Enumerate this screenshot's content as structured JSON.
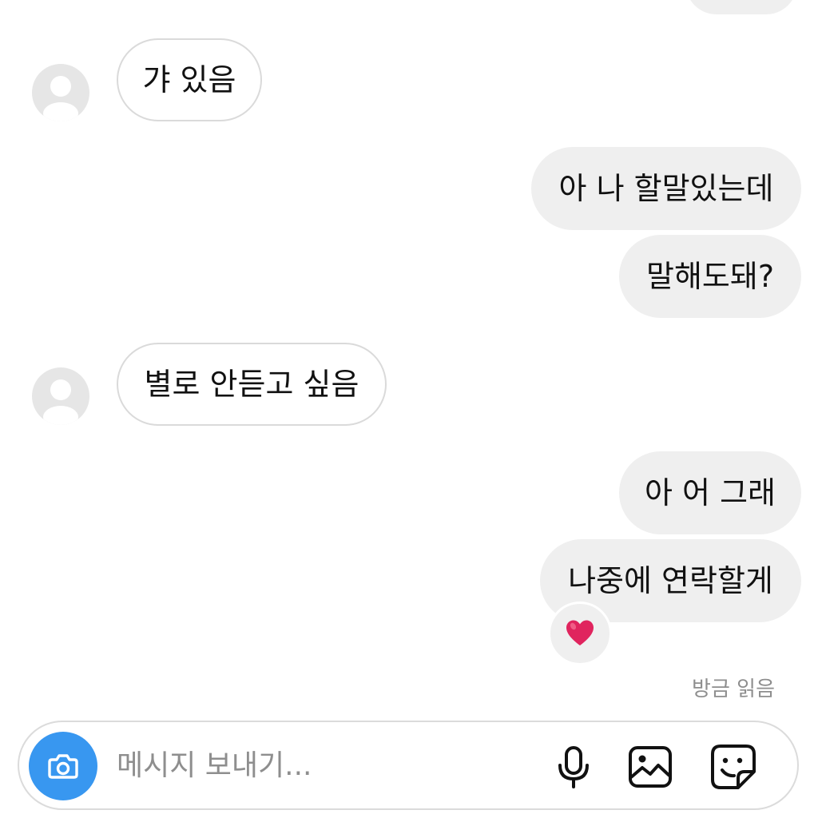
{
  "messages": [
    {
      "text": "갸 있음"
    },
    {
      "text": "아 나 할말있는데"
    },
    {
      "text": "말해도돼?"
    },
    {
      "text": "별로 안듣고 싶음"
    },
    {
      "text": "아 어 그래"
    },
    {
      "text": "나중에 연락할게"
    }
  ],
  "reaction": {
    "emoji": "❤️",
    "icon": "heart-icon"
  },
  "read_status": "방금 읽음",
  "composer": {
    "placeholder": "메시지 보내기...",
    "value": "",
    "icons": [
      "camera-icon",
      "microphone-icon",
      "gallery-icon",
      "sticker-icon"
    ]
  },
  "colors": {
    "accent": "#3897f0",
    "sent_bubble": "#efefef",
    "received_border": "#dadada",
    "avatar_bg": "#e6e6e6",
    "heart": "#e0245e"
  }
}
